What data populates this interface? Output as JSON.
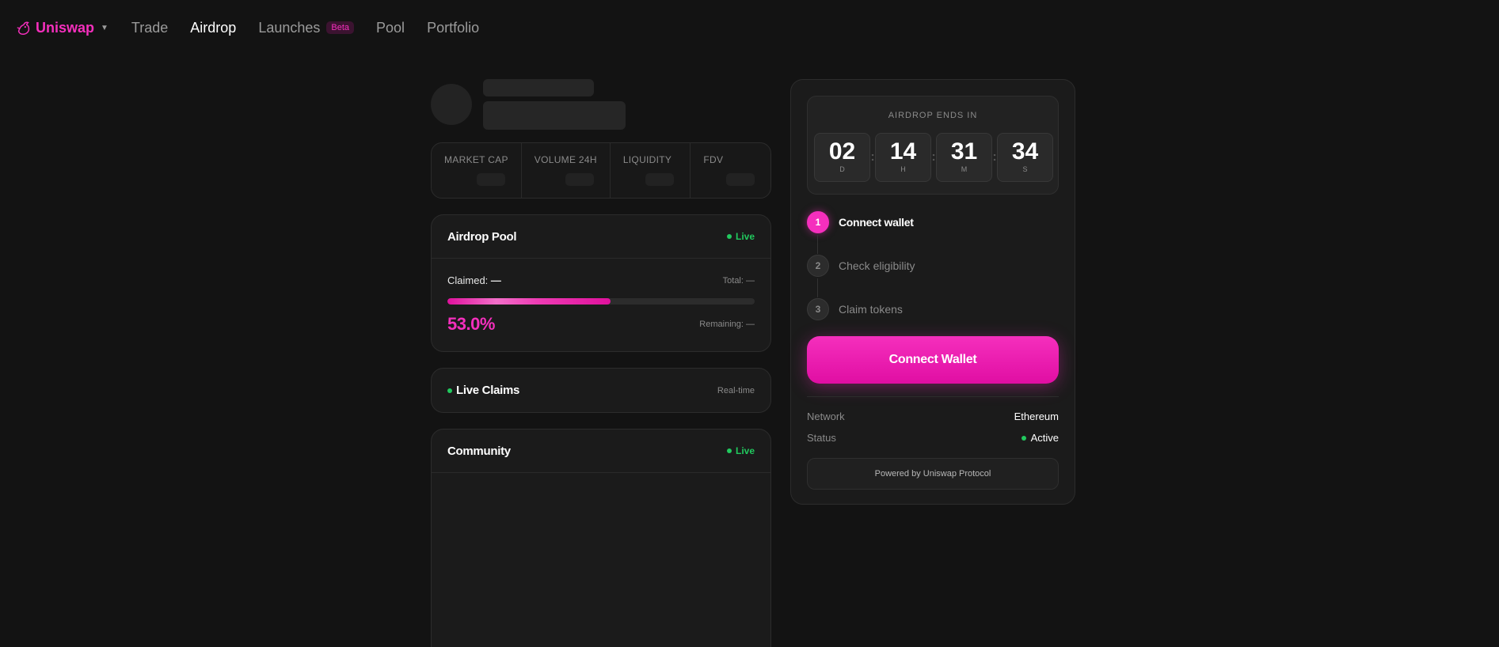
{
  "nav": {
    "brand": "Uniswap",
    "links": [
      {
        "label": "Trade"
      },
      {
        "label": "Airdrop",
        "active": true
      },
      {
        "label": "Launches",
        "badge": "Beta"
      },
      {
        "label": "Pool"
      },
      {
        "label": "Portfolio"
      }
    ]
  },
  "stats": {
    "market_cap": "MARKET CAP",
    "volume": "VOLUME 24H",
    "liquidity": "LIQUIDITY",
    "fdv": "FDV"
  },
  "airdrop_pool": {
    "title": "Airdrop Pool",
    "status": "Live",
    "claimed_label": "Claimed:",
    "claimed_value": "—",
    "total": "Total: —",
    "progress_percent": 53.0,
    "percent_text": "53.0%",
    "remaining": "Remaining: —"
  },
  "live_claims": {
    "title": "Live Claims",
    "tag": "Real-time"
  },
  "community": {
    "title": "Community",
    "status": "Live"
  },
  "countdown": {
    "label": "AIRDROP ENDS IN",
    "units": [
      {
        "value": "02",
        "letter": "D"
      },
      {
        "value": "14",
        "letter": "H"
      },
      {
        "value": "31",
        "letter": "M"
      },
      {
        "value": "34",
        "letter": "S"
      }
    ]
  },
  "steps": [
    {
      "num": "1",
      "label": "Connect wallet",
      "active": true
    },
    {
      "num": "2",
      "label": "Check eligibility",
      "active": false
    },
    {
      "num": "3",
      "label": "Claim tokens",
      "active": false
    }
  ],
  "connect_button": "Connect Wallet",
  "info": {
    "network_label": "Network",
    "network_value": "Ethereum",
    "status_label": "Status",
    "status_value": "Active"
  },
  "powered_by": "Powered by Uniswap Protocol",
  "colors": {
    "accent": "#f52fbd",
    "live_green": "#21c95e",
    "background": "#131313"
  }
}
